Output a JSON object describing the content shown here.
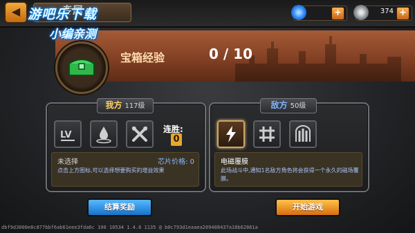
{
  "header": {
    "title": "专属",
    "back_icon": "back-icon"
  },
  "watermark": {
    "line1": "游吧乐下载",
    "line2": "小编亲测"
  },
  "resources": [
    {
      "icon": "gem-icon",
      "value": "",
      "color": "#2f8bff"
    },
    {
      "icon": "fist-icon",
      "value": "374",
      "color": "#9aa0a6"
    }
  ],
  "exp": {
    "label": "宝箱经验",
    "value": "0 / 10"
  },
  "player": {
    "title": "我方",
    "level": "117级",
    "slots": [
      "lv-icon",
      "drop-icon",
      "tools-icon"
    ],
    "streak_label": "连胜:",
    "streak_value": "0",
    "desc_title": "未选择",
    "price_label": "芯片价格: 0",
    "desc_text": "点击上方图标,可以选择想要购买的增益效果"
  },
  "enemy": {
    "title": "敌方",
    "level": "50级",
    "slots": [
      "lightning-icon",
      "grid-icon",
      "bars-icon"
    ],
    "desc_title": "电磁覆膜",
    "desc_text": "此场战斗中,通知1名敌方角色将会获得一个永久的磁场覆膜。"
  },
  "buttons": {
    "settle": "结算奖励",
    "start": "开始游戏"
  },
  "footer": "dbf9d3000e8c877bbf6ab61eee3fda6c 100 10534 1.4.6 1135 @ b0c793d1eaaea209408437a18b62861a"
}
